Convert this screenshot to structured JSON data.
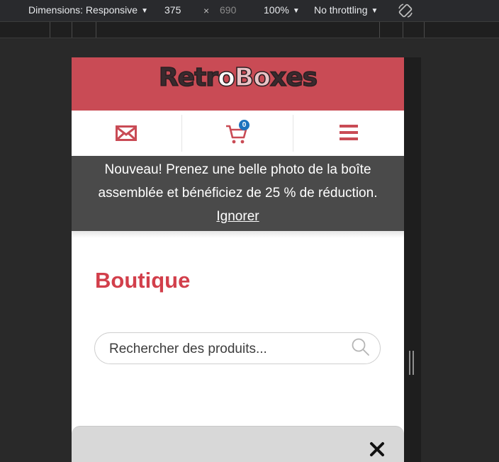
{
  "devtools": {
    "dimensions_label": "Dimensions: Responsive",
    "width": "375",
    "times": "×",
    "height": "690",
    "zoom": "100%",
    "throttling": "No throttling",
    "rotate_icon": "rotate-icon"
  },
  "site": {
    "logo": {
      "part1": "Retr",
      "part2": "o",
      "part3": "Bo",
      "part4": "xes"
    },
    "nav": {
      "mail_icon": "mail-icon",
      "cart_icon": "cart-icon",
      "cart_count": "0",
      "menu_icon": "hamburger-menu-icon"
    },
    "notice": {
      "message": "Nouveau! Prenez une belle photo de la boîte assemblée et bénéficiez de 25 % de réduction.",
      "dismiss": "Ignorer"
    },
    "page_title": "Boutique",
    "search": {
      "placeholder": "Rechercher des produits...",
      "icon": "search-icon"
    },
    "panel": {
      "close_icon": "close-icon"
    }
  },
  "colors": {
    "header_bg": "#c94b55",
    "accent": "#d23f4b",
    "notice_bg": "#4a4a4a",
    "badge": "#1e73be"
  }
}
